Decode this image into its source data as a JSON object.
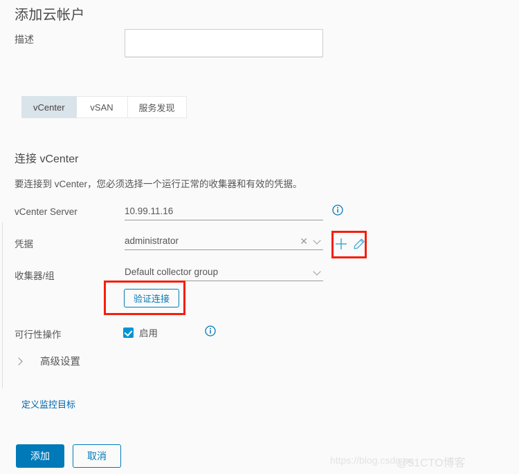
{
  "dialog": {
    "title": "添加云帐户"
  },
  "description_row": {
    "label": "描述",
    "value": "",
    "placeholder": ""
  },
  "tabs": [
    {
      "label": "vCenter",
      "active": true
    },
    {
      "label": "vSAN",
      "active": false
    },
    {
      "label": "服务发现",
      "active": false
    }
  ],
  "section": {
    "title": "连接 vCenter",
    "description": "要连接到 vCenter，您必须选择一个运行正常的收集器和有效的凭据。"
  },
  "fields": {
    "vcenter_server": {
      "label": "vCenter Server",
      "value": "10.99.11.16",
      "info_icon": "info-circle-icon"
    },
    "credential": {
      "label": "凭据",
      "value": "administrator",
      "clear_icon": "close-icon",
      "chevron_icon": "chevron-down-icon",
      "add_icon": "plus-icon",
      "edit_icon": "pencil-icon"
    },
    "collector_group": {
      "label": "收集器/组",
      "value": "Default collector group",
      "chevron_icon": "chevron-down-icon"
    },
    "validate": {
      "button_label": "验证连接"
    },
    "actionable": {
      "label": "可行性操作",
      "checkbox_label": "启用",
      "checked": true,
      "info_icon": "info-circle-icon"
    }
  },
  "advanced": {
    "label": "高级设置",
    "chevron_icon": "chevron-right-icon",
    "expanded": false
  },
  "links": {
    "define_targets": "定义监控目标"
  },
  "footer": {
    "submit_label": "添加",
    "cancel_label": "取消"
  },
  "watermarks": {
    "url": "https://blog.csdn.ne",
    "brand": "@51CTO博客"
  },
  "colors": {
    "accent": "#0079b8",
    "checkbox": "#0095d3",
    "link": "#0065ab",
    "annotation": "#f61d0a",
    "active_tab_bg": "#d9e4ea",
    "background": "#fafafa"
  }
}
